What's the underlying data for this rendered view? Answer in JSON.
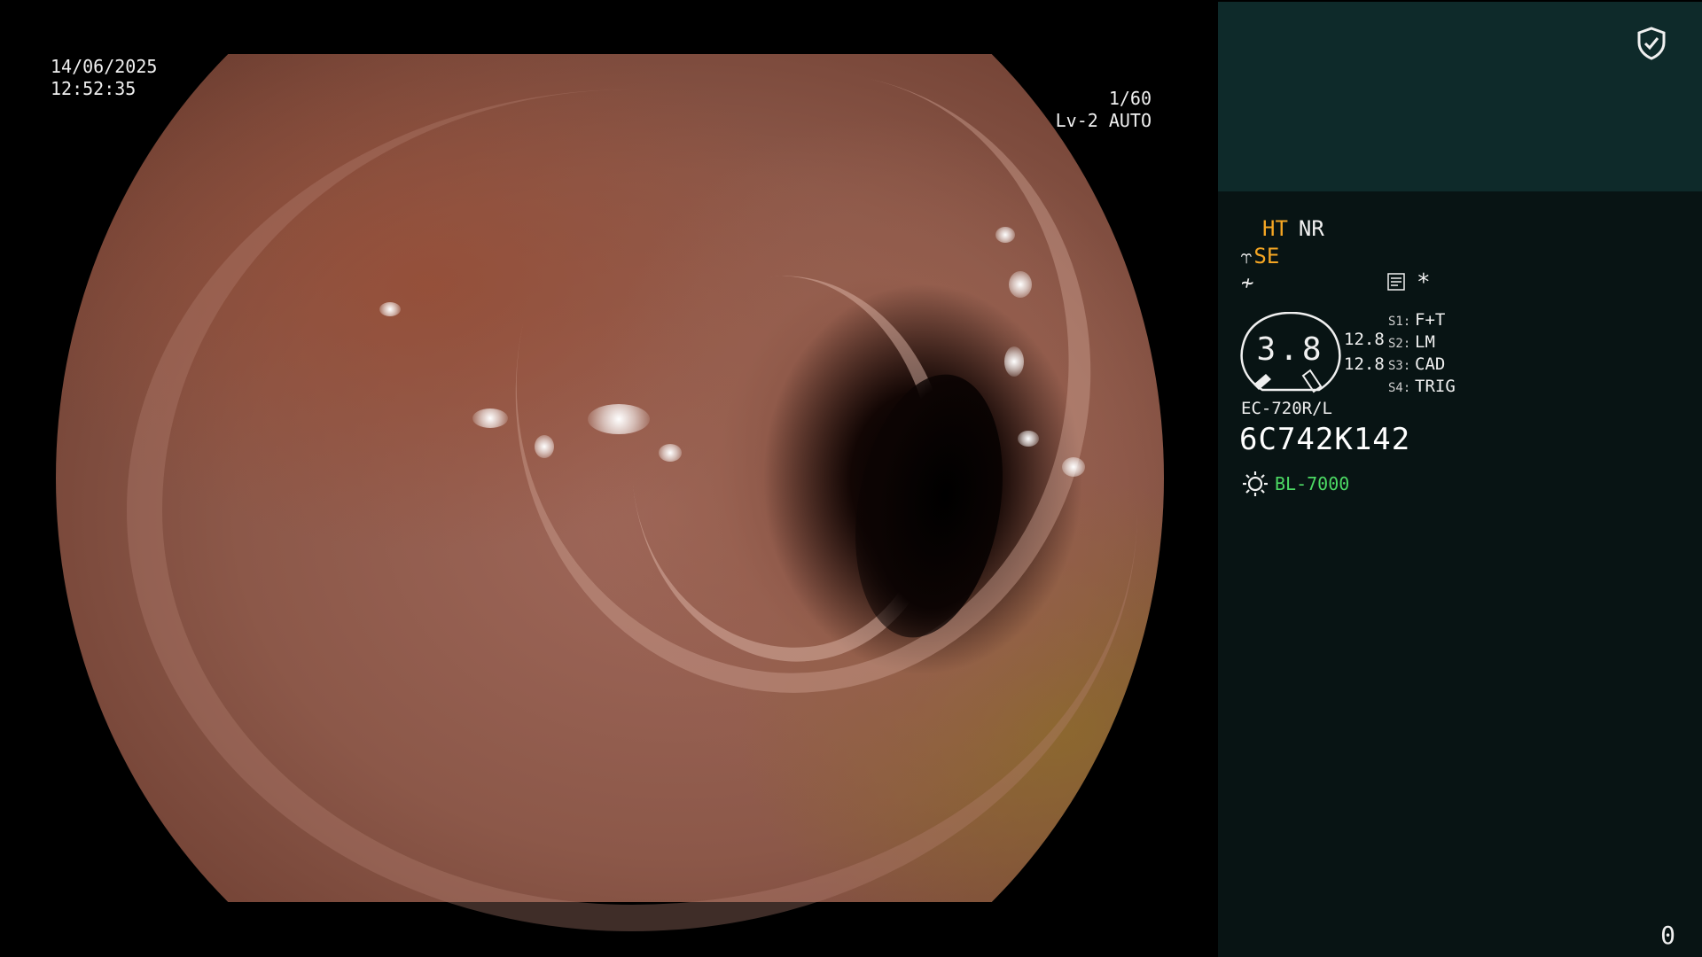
{
  "video": {
    "date": "14/06/2025",
    "time": "12:52:35",
    "shutter": "1/60",
    "shutter_icon": "aperture-icon",
    "iris_mode": "Lv-2 AUTO",
    "iris_icon": "iris-icon"
  },
  "panel": {
    "top_icon": "shield-check-icon",
    "ht_label": "HT",
    "nr_label": "NR",
    "se_label": "SE",
    "se_icon": "zoom-lever-icon",
    "f_icon": "enhancement-icon",
    "memo_icon": "memo-icon",
    "asterisk": "*",
    "gauge_value": "3.8",
    "gauge_side_1": "12.8",
    "gauge_side_2": "12.8",
    "slots": [
      {
        "key": "S1:",
        "value": "F+T"
      },
      {
        "key": "S2:",
        "value": "LM"
      },
      {
        "key": "S3:",
        "value": "CAD"
      },
      {
        "key": "S4:",
        "value": "TRIG"
      }
    ],
    "scope_model": "EC-720R/L",
    "scope_serial": "6C742K142",
    "light_source": "BL-7000",
    "light_icon": "lamp-icon",
    "counter": "0"
  },
  "colors": {
    "panel_top_bg": "#0e2a2a",
    "panel_bottom_bg": "#081414",
    "accent_orange": "#f5a623",
    "light_green": "#4cd964"
  }
}
